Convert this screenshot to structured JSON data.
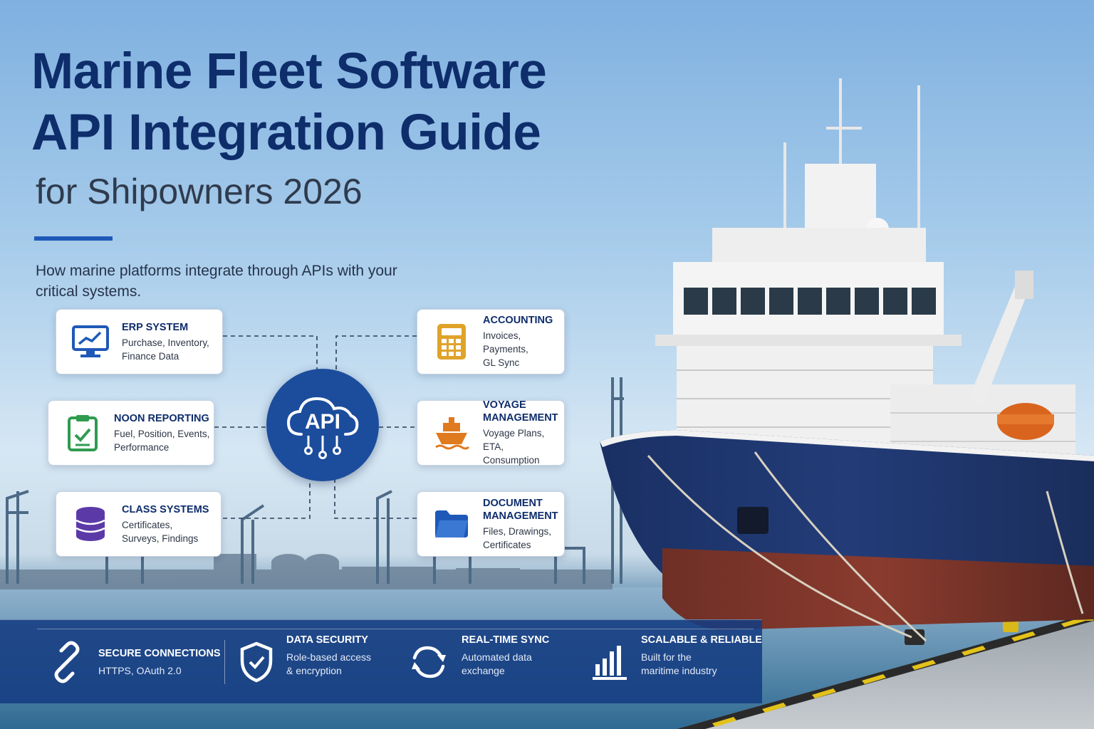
{
  "header": {
    "title_line1": "Marine Fleet Software",
    "title_line2": "API Integration Guide",
    "subtitle": "for Shipowners 2026",
    "lede": "How marine platforms integrate through APIs with your critical systems."
  },
  "hub": {
    "label": "API",
    "icon": "cloud-icon"
  },
  "systems": [
    {
      "title": "ERP SYSTEM",
      "desc_line1": "Purchase, Inventory,",
      "desc_line2": "Finance Data",
      "icon": "monitor-chart-icon",
      "color": "#1f59b8"
    },
    {
      "title": "ACCOUNTING",
      "desc_line1": "Invoices, Payments,",
      "desc_line2": "GL Sync",
      "icon": "calculator-icon",
      "color": "#e0a32a"
    },
    {
      "title": "NOON REPORTING",
      "desc_line1": "Fuel, Position, Events,",
      "desc_line2": "Performance",
      "icon": "clipboard-check-icon",
      "color": "#2f9b4e"
    },
    {
      "title_line1": "VOYAGE",
      "title_line2": "MANAGEMENT",
      "desc_line1": "Voyage Plans, ETA,",
      "desc_line2": "Consumption",
      "icon": "ship-icon",
      "color": "#e07a1f"
    },
    {
      "title": "CLASS SYSTEMS",
      "desc_line1": "Certificates,",
      "desc_line2": "Surveys, Findings",
      "icon": "database-icon",
      "color": "#5b3aa8"
    },
    {
      "title_line1": "DOCUMENT",
      "title_line2": "MANAGEMENT",
      "desc_line1": "Files, Drawings,",
      "desc_line2": "Certificates",
      "icon": "folder-icon",
      "color": "#1f59b8"
    }
  ],
  "features": [
    {
      "title": "SECURE CONNECTIONS",
      "desc_line1": "HTTPS, OAuth 2.0",
      "desc_line2": "",
      "icon": "link-icon"
    },
    {
      "title": "DATA SECURITY",
      "desc_line1": "Role-based access",
      "desc_line2": "& encryption",
      "icon": "shield-icon"
    },
    {
      "title": "REAL-TIME SYNC",
      "desc_line1": "Automated data",
      "desc_line2": "exchange",
      "icon": "sync-icon"
    },
    {
      "title": "SCALABLE & RELIABLE",
      "desc_line1": "Built for the",
      "desc_line2": "maritime industry",
      "icon": "bar-chart-icon"
    }
  ]
}
